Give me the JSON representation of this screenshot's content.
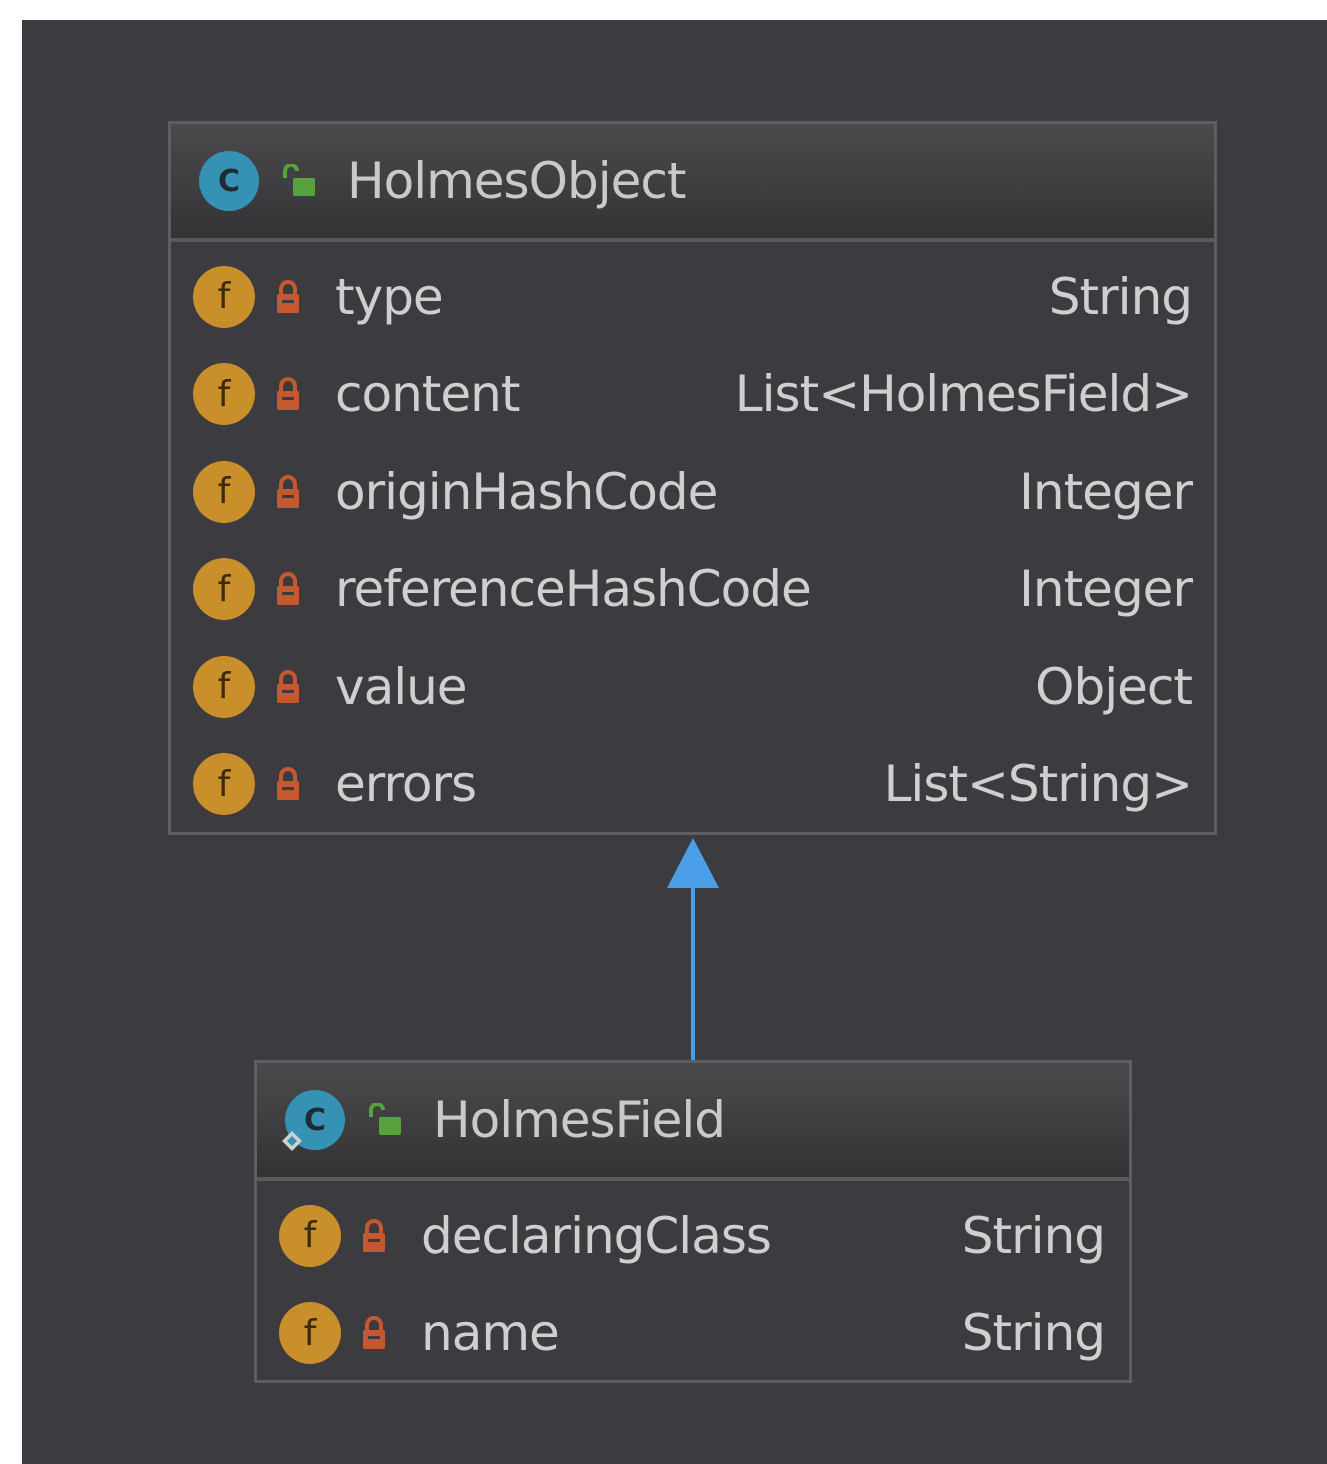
{
  "classes": [
    {
      "name": "HolmesObject",
      "icon": "class-icon",
      "icon_letter": "C",
      "visibility_icon": "public-open-lock-icon",
      "fields": [
        {
          "icon_letter": "f",
          "name": "type",
          "type": "String"
        },
        {
          "icon_letter": "f",
          "name": "content",
          "type": "List<HolmesField>"
        },
        {
          "icon_letter": "f",
          "name": "originHashCode",
          "type": "Integer"
        },
        {
          "icon_letter": "f",
          "name": "referenceHashCode",
          "type": "Integer"
        },
        {
          "icon_letter": "f",
          "name": "value",
          "type": "Object"
        },
        {
          "icon_letter": "f",
          "name": "errors",
          "type": "List<String>"
        }
      ]
    },
    {
      "name": "HolmesField",
      "icon": "class-icon",
      "icon_letter": "C",
      "visibility_icon": "public-open-lock-icon",
      "fields": [
        {
          "icon_letter": "f",
          "name": "declaringClass",
          "type": "String"
        },
        {
          "icon_letter": "f",
          "name": "name",
          "type": "String"
        }
      ]
    }
  ],
  "relations": [
    {
      "kind": "inheritance",
      "from": "HolmesField",
      "to": "HolmesObject"
    }
  ],
  "colors": {
    "background": "#3c3b3f",
    "class_icon": "#3592b4",
    "field_icon": "#c98f2a",
    "private_lock": "#c4582e",
    "public_lock": "#58a23c",
    "arrow": "#4a9fe8",
    "text": "#cfcfcf"
  }
}
